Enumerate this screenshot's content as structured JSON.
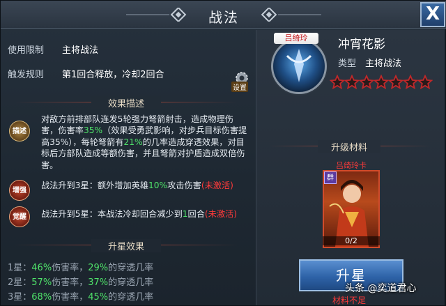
{
  "title": "战法",
  "close_label": "X",
  "left": {
    "rows": [
      {
        "label": "使用限制",
        "value": "主将战法"
      },
      {
        "label": "触发规则",
        "value": "第1回合释放，冷却2回合"
      }
    ],
    "settings_label": "设置",
    "effect_header": "效果描述",
    "badges": [
      {
        "name": "描述",
        "color": "#7a5b2a"
      },
      {
        "name": "增强",
        "color": "#8a2a1a"
      },
      {
        "name": "觉醒",
        "color": "#8a2a1a"
      }
    ],
    "desc_parts": {
      "p1": "对敌方前排部队连发5轮强力弩箭射击，造成物理伤害，伤害率",
      "p1_hl": "35%",
      "p2": "（效果受勇武影响，对步兵目标伤害提高35%），每轮弩箭有",
      "p2_hl": "21%",
      "p3": "的几率造成穿透效果，对目标后方部队造成等额伤害，并且弩箭对护盾造成双倍伤害。"
    },
    "enhance": {
      "pre": "战法升到3星：额外增加英雄",
      "hl": "10%",
      "post": "攻击伤害",
      "status": "(未激活)"
    },
    "awaken": {
      "pre": "战法升到5星：本战法冷却回合减少到",
      "hl": "1",
      "post": "回合",
      "status": "(未激活)"
    },
    "star_header": "升星效果",
    "star_effects": [
      {
        "star": "1星：",
        "dmg": "46%",
        "dmg_label": "伤害率，",
        "pen": "29%",
        "pen_label": "的穿透几率"
      },
      {
        "star": "2星：",
        "dmg": "57%",
        "dmg_label": "伤害率，",
        "pen": "37%",
        "pen_label": "的穿透几率"
      },
      {
        "star": "3星：",
        "dmg": "68%",
        "dmg_label": "伤害率，",
        "pen": "45%",
        "pen_label": "的穿透几率"
      }
    ]
  },
  "right": {
    "hero_tag": "吕绮玲",
    "skill_name": "冲宵花影",
    "type_label": "类型",
    "type_value": "主将战法",
    "stars_filled": 0,
    "stars_total": 7,
    "material_header": "升级材料",
    "card_label": "吕绮玲卡",
    "faction": "群",
    "card_count": "0/2",
    "upgrade_button": "升星",
    "insufficient": "材料不足"
  },
  "watermark": "头条 @奕道君心",
  "colors": {
    "highlight_green": "#4fe36a",
    "inactive_red": "#ff3a3a",
    "button_blue": "#2e63a8"
  }
}
